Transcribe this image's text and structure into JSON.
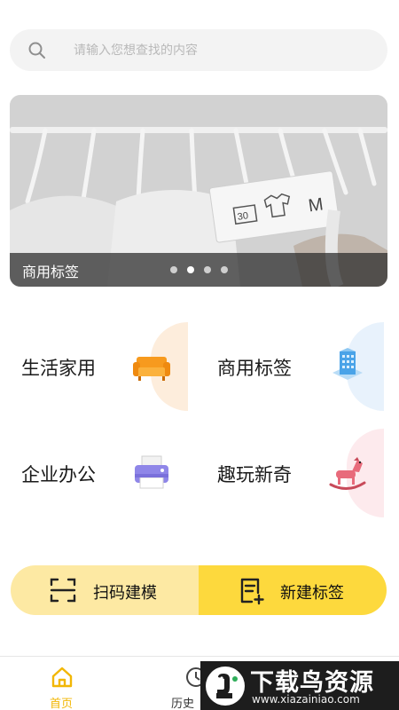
{
  "search": {
    "placeholder": "请输入您想查找的内容",
    "icon": "search-icon"
  },
  "banner": {
    "caption": "商用标签",
    "slide_count": 4,
    "active_index": 1,
    "tag_text": {
      "wash_temp": "30",
      "size": "M"
    }
  },
  "categories": [
    {
      "label": "生活家用",
      "icon": "sofa-icon",
      "accent": "#fde9d6"
    },
    {
      "label": "商用标签",
      "icon": "building-icon",
      "accent": "#e6f1fb"
    },
    {
      "label": "企业办公",
      "icon": "printer-icon",
      "accent": "#f3eefb"
    },
    {
      "label": "趣玩新奇",
      "icon": "rocking-horse-icon",
      "accent": "#fde7ea"
    }
  ],
  "actions": {
    "scan": {
      "label": "扫码建模",
      "icon": "scan-icon"
    },
    "create": {
      "label": "新建标签",
      "icon": "new-document-icon"
    }
  },
  "tabbar": {
    "home": {
      "label": "首页",
      "icon": "home-icon"
    },
    "history": {
      "label": "历史",
      "icon": "history-icon"
    }
  },
  "colors": {
    "accent": "#fdd93d",
    "accent_light": "#fde9a3",
    "tab_active": "#f2b705"
  },
  "watermark": {
    "title": "下载鸟资源",
    "url": "www.xiazainiao.com"
  }
}
